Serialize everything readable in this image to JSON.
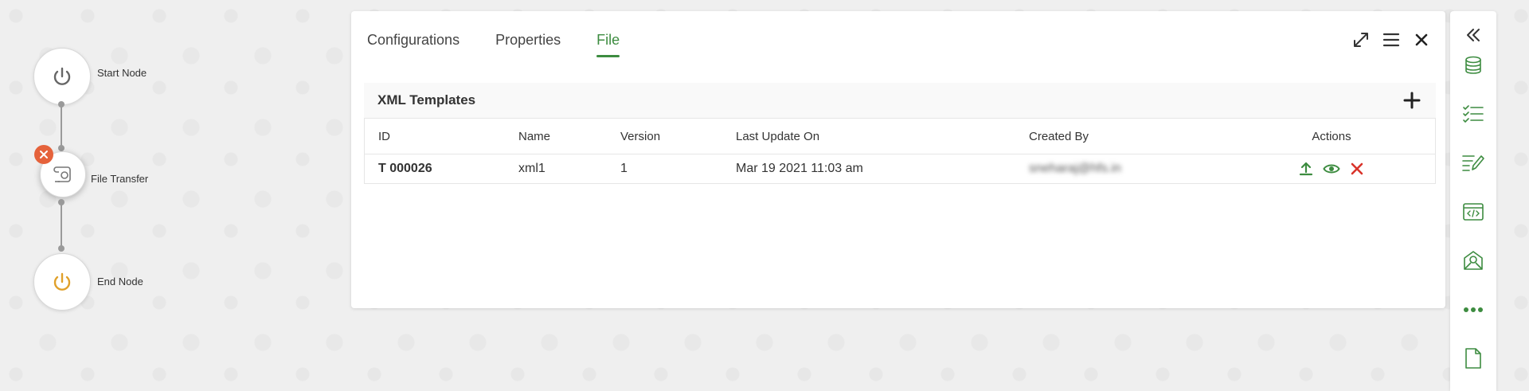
{
  "flow": {
    "start_node": {
      "label": "Start Node",
      "icon": "power-icon"
    },
    "file_transfer_node": {
      "label": "File Transfer",
      "icon": "file-transfer-icon"
    },
    "end_node": {
      "label": "End Node",
      "icon": "power-icon"
    }
  },
  "panel": {
    "tabs": [
      {
        "label": "Configurations",
        "active": false
      },
      {
        "label": "Properties",
        "active": false
      },
      {
        "label": "File",
        "active": true
      }
    ],
    "tools": [
      "expand-icon",
      "menu-icon",
      "close-icon"
    ]
  },
  "templates": {
    "title": "XML Templates",
    "columns": [
      "ID",
      "Name",
      "Version",
      "Last Update On",
      "Created By",
      "Actions"
    ],
    "rows": [
      {
        "id": "T 000026",
        "name": "xml1",
        "version": "1",
        "last_update": "Mar 19 2021 11:03 am",
        "created_by": "sneharaj@hfs.in"
      }
    ]
  },
  "sidebar": {
    "items": [
      "collapse-icon",
      "database-icon",
      "checklist-icon",
      "edit-list-icon",
      "code-window-icon",
      "mail-icon",
      "more-icon",
      "document-icon"
    ]
  },
  "colors": {
    "accent": "#3d8c40",
    "danger": "#e5623b",
    "end_node_icon": "#e0a02a"
  }
}
